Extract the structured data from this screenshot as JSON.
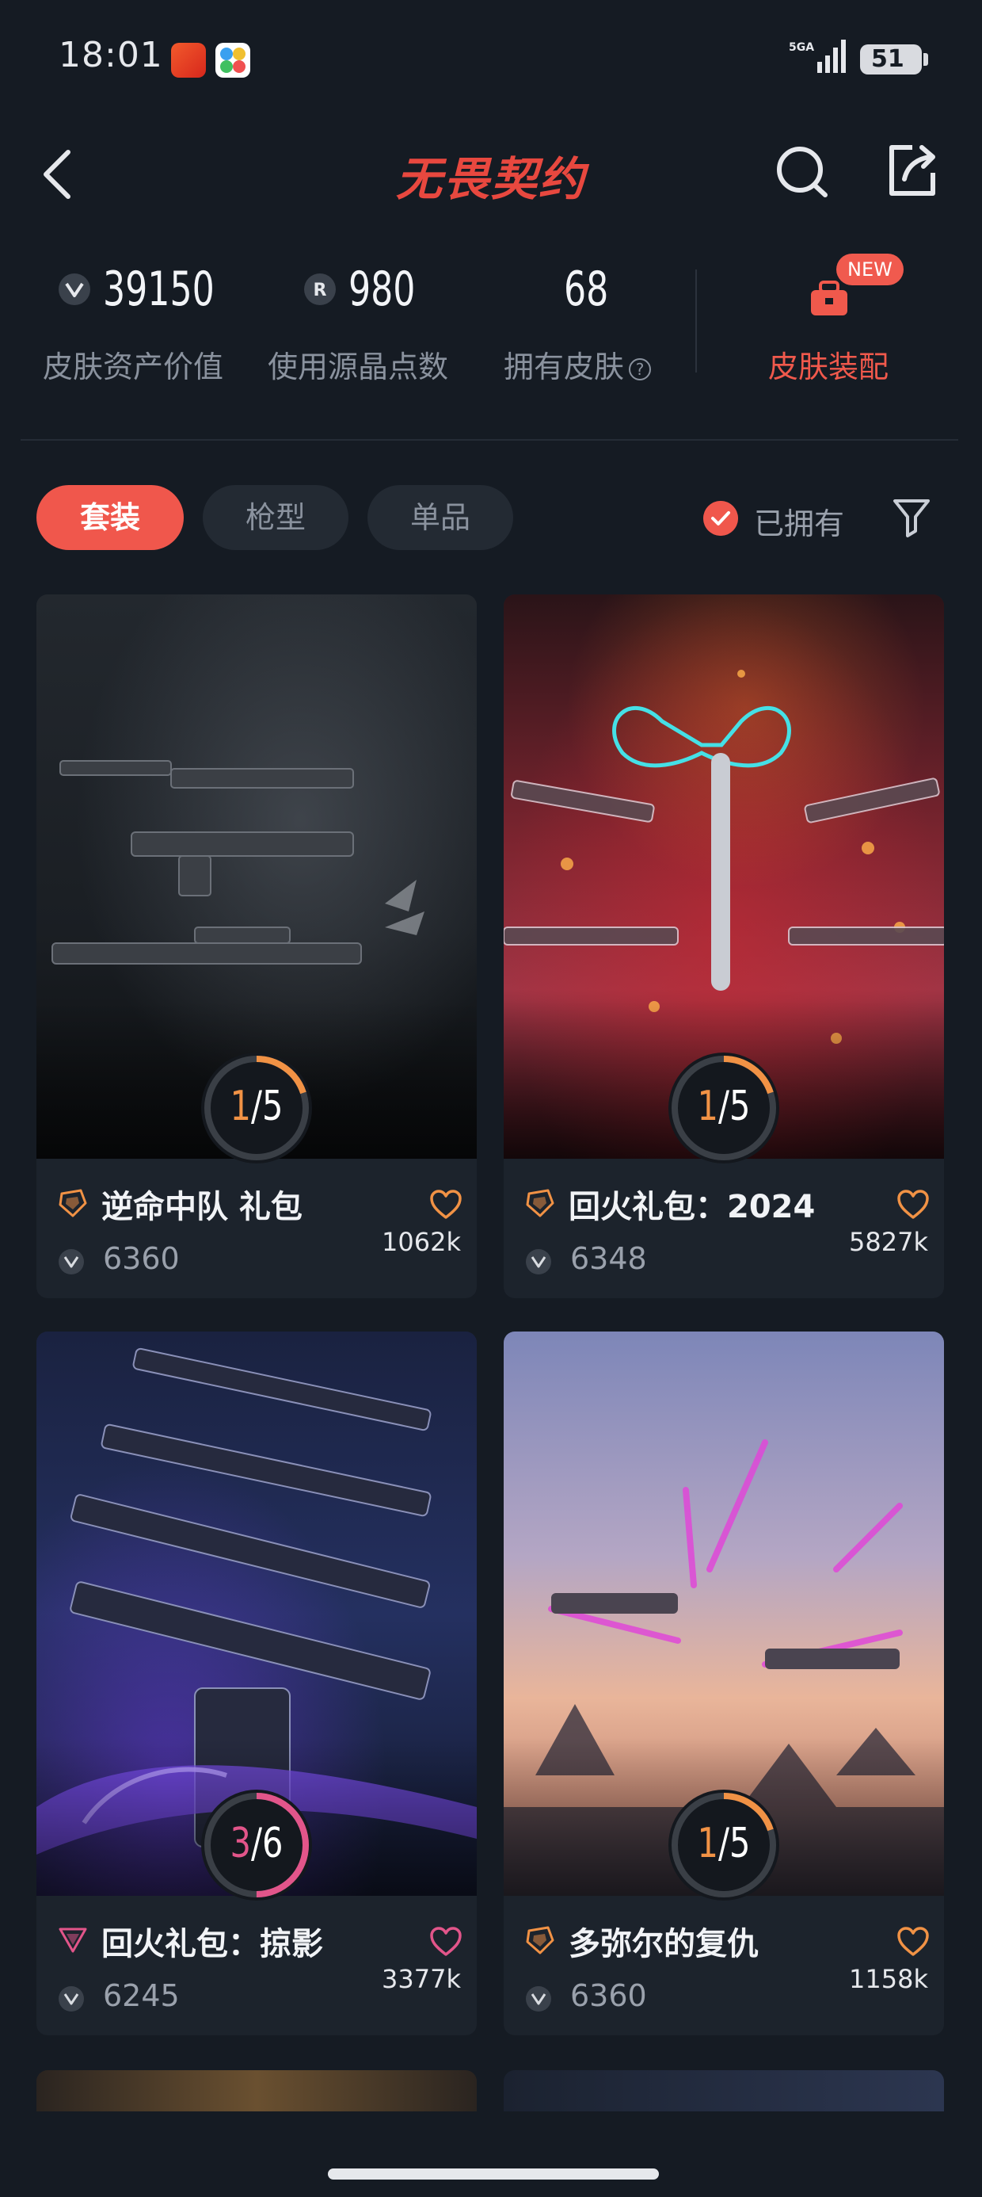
{
  "status_bar": {
    "time": "18:01",
    "network": "5GA",
    "battery": "51"
  },
  "header": {
    "logo_text": "无畏契约"
  },
  "stats": {
    "asset_value": "39150",
    "asset_label": "皮肤资产价值",
    "points_value": "980",
    "points_label": "使用源晶点数",
    "skins_value": "68",
    "skins_label": "拥有皮肤",
    "equip_badge": "NEW",
    "equip_label": "皮肤装配"
  },
  "filters": {
    "tabs": [
      {
        "label": "套装",
        "active": true
      },
      {
        "label": "枪型",
        "active": false
      },
      {
        "label": "单品",
        "active": false
      }
    ],
    "owned_label": "已拥有"
  },
  "cards": [
    {
      "title": "逆命中队 礼包",
      "owned": "1",
      "total": "5",
      "price": "6360",
      "likes": "1062k",
      "tier": "premium"
    },
    {
      "title": "回火礼包：2024",
      "owned": "1",
      "total": "5",
      "price": "6348",
      "likes": "5827k",
      "tier": "premium"
    },
    {
      "title": "回火礼包：掠影",
      "owned": "3",
      "total": "6",
      "price": "6245",
      "likes": "3377k",
      "tier": "exclusive"
    },
    {
      "title": "多弥尔的复仇",
      "owned": "1",
      "total": "5",
      "price": "6360",
      "likes": "1158k",
      "tier": "premium"
    }
  ],
  "colors": {
    "accent": "#f0574c",
    "progress_orange": "#f19245",
    "progress_pink": "#e2558a",
    "background": "#151b23",
    "card": "#1c232c"
  }
}
